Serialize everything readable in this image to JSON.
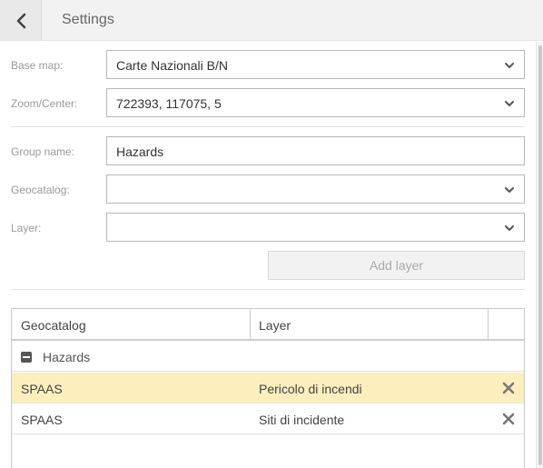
{
  "header": {
    "title": "Settings",
    "back_icon": "chevron-left-icon"
  },
  "form": {
    "base_map": {
      "label": "Base map:",
      "value": "Carte Nazionali B/N"
    },
    "zoom_center": {
      "label": "Zoom/Center:",
      "value": "722393, 117075, 5"
    },
    "group_name": {
      "label": "Group name:",
      "value": "Hazards"
    },
    "geocatalog": {
      "label": "Geocatalog:",
      "value": ""
    },
    "layer": {
      "label": "Layer:",
      "value": ""
    },
    "add_layer_label": "Add layer"
  },
  "table": {
    "columns": [
      "Geocatalog",
      "Layer",
      ""
    ],
    "group": {
      "label": "Hazards",
      "icon": "collapse-minus-icon"
    },
    "rows": [
      {
        "geocatalog": "SPAAS",
        "layer": "Pericolo di incendi",
        "selected": true
      },
      {
        "geocatalog": "SPAAS",
        "layer": "Siti di incidente",
        "selected": false
      }
    ],
    "remove_icon": "close-x-icon"
  },
  "colors": {
    "selected_row": "#fcefbd",
    "header_bg": "#f2f2f2",
    "border": "#b8b8b8"
  }
}
